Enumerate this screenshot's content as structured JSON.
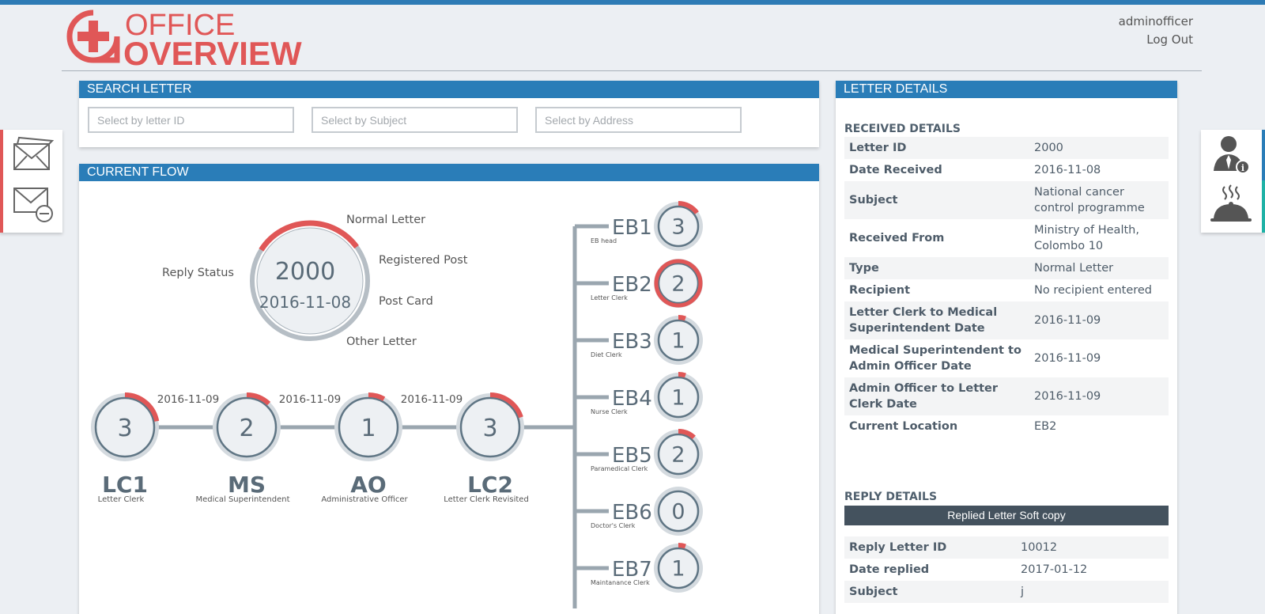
{
  "brand": {
    "line1": "OFFICE",
    "line2": "OVERVIEW"
  },
  "user": {
    "name": "adminofficer",
    "logout": "Log Out"
  },
  "search": {
    "title": "SEARCH LETTER",
    "letter_id_placeholder": "Select by letter ID",
    "subject_placeholder": "Select by Subject",
    "address_placeholder": "Select by Address"
  },
  "flow": {
    "title": "CURRENT FLOW",
    "reply_status": "Reply Status",
    "letter_id": "2000",
    "date": "2016-11-08",
    "types": [
      "Normal Letter",
      "Registered Post",
      "Post Card",
      "Other Letter"
    ],
    "stages": [
      {
        "code": "LC1",
        "name": "Letter Clerk",
        "count": "3",
        "progress": 0.22
      },
      {
        "code": "MS",
        "name": "Medical Superintendent",
        "count": "2",
        "progress": 0.12
      },
      {
        "code": "AO",
        "name": "Administrative Officer",
        "count": "1",
        "progress": 0.08
      },
      {
        "code": "LC2",
        "name": "Letter Clerk Revisited",
        "count": "3",
        "progress": 0.2
      }
    ],
    "transition_dates": [
      "2016-11-09",
      "2016-11-09",
      "2016-11-09"
    ],
    "branches": [
      {
        "code": "EB1",
        "name": "EB head",
        "count": "3",
        "progress": 0.15,
        "current": false
      },
      {
        "code": "EB2",
        "name": "Letter Clerk",
        "count": "2",
        "progress": 1.0,
        "current": true
      },
      {
        "code": "EB3",
        "name": "Diet Clerk",
        "count": "1",
        "progress": 0.05,
        "current": false
      },
      {
        "code": "EB4",
        "name": "Nurse Clerk",
        "count": "1",
        "progress": 0.05,
        "current": false
      },
      {
        "code": "EB5",
        "name": "Paramedical Clerk",
        "count": "2",
        "progress": 0.12,
        "current": false
      },
      {
        "code": "EB6",
        "name": "Doctor's Clerk",
        "count": "0",
        "progress": 0,
        "current": false
      },
      {
        "code": "EB7",
        "name": "Maintanance Clerk",
        "count": "1",
        "progress": 0.05,
        "current": false
      }
    ]
  },
  "details": {
    "title": "LETTER DETAILS",
    "received_title": "RECEIVED DETAILS",
    "received": [
      {
        "key": "Letter ID",
        "value": "2000"
      },
      {
        "key": "Date Received",
        "value": "2016-11-08"
      },
      {
        "key": "Subject",
        "value": "National cancer control programme"
      },
      {
        "key": "Received From",
        "value": "Ministry of Health, Colombo 10"
      },
      {
        "key": "Type",
        "value": "Normal Letter"
      },
      {
        "key": "Recipient",
        "value": "No recipient entered"
      },
      {
        "key": "Letter Clerk to Medical Superintendent Date",
        "value": "2016-11-09"
      },
      {
        "key": "Medical Superintendent to Admin Officer Date",
        "value": "2016-11-09"
      },
      {
        "key": "Admin Officer to Letter Clerk Date",
        "value": "2016-11-09"
      },
      {
        "key": "Current Location",
        "value": "EB2"
      }
    ],
    "reply_title": "REPLY DETAILS",
    "soft_copy_button": "Replied Letter Soft copy",
    "reply": [
      {
        "key": "Reply Letter ID",
        "value": "10012"
      },
      {
        "key": "Date replied",
        "value": "2017-01-12"
      },
      {
        "key": "Subject",
        "value": "j"
      }
    ]
  },
  "colors": {
    "accent": "#2a7db8",
    "brand": "#e05757",
    "ring": "#5f7584",
    "ring_bg": "#d4dadf"
  },
  "sidebar_left": [
    "envelope-icon",
    "envelope-remove-icon"
  ],
  "sidebar_right": [
    "user-info-icon",
    "food-tray-icon"
  ]
}
